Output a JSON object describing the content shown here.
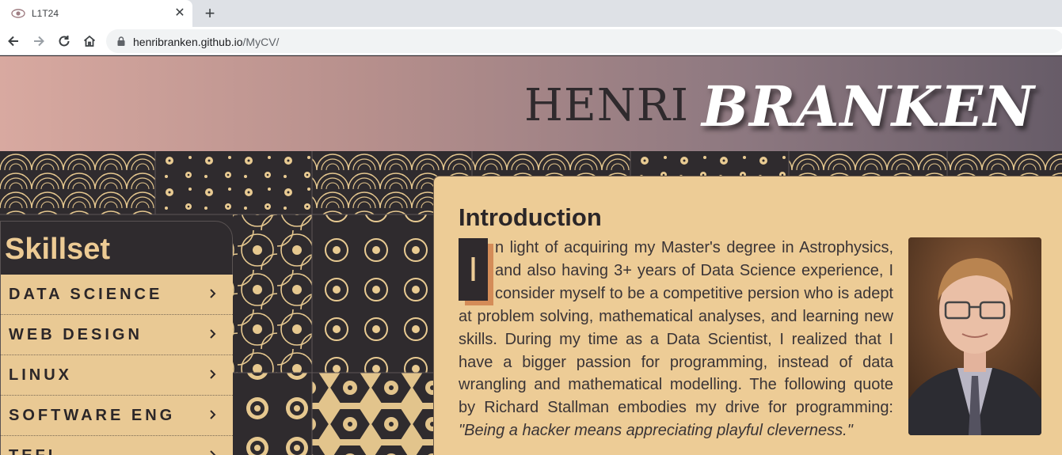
{
  "browser": {
    "tab_title": "L1T24",
    "url_host": "henribranken.github.io",
    "url_path": "/MyCV/",
    "new_tab_symbol": "+",
    "close_symbol": "✕"
  },
  "header": {
    "first_name": "HENRI",
    "last_name": "BRANKEN"
  },
  "skillset": {
    "title": "Skillset",
    "items": [
      {
        "label": "DATA SCIENCE"
      },
      {
        "label": "WEB DESIGN"
      },
      {
        "label": "LINUX"
      },
      {
        "label": "SOFTWARE ENG"
      },
      {
        "label": "TEFL"
      }
    ]
  },
  "intro": {
    "title": "Introduction",
    "drop_cap": "I",
    "body": "n light of acquiring my Master's degree in Astrophysics, and also having 3+ years of Data Science experience, I consider myself to be a competitive persion who is adept at problem solving, mathematical analyses, and learning new skills. During my time as a Data Scientist, I realized that I have a bigger passion for programming, instead of data wrangling and mathematical modelling. The following quote by Richard Stallman embodies my drive for programming: ",
    "quote": "\"Being a hacker means appreciating playful cleverness.\""
  },
  "colors": {
    "accent": "#edcc96",
    "dark": "#2f2a2d",
    "dropcap_shadow": "#d48c58"
  }
}
